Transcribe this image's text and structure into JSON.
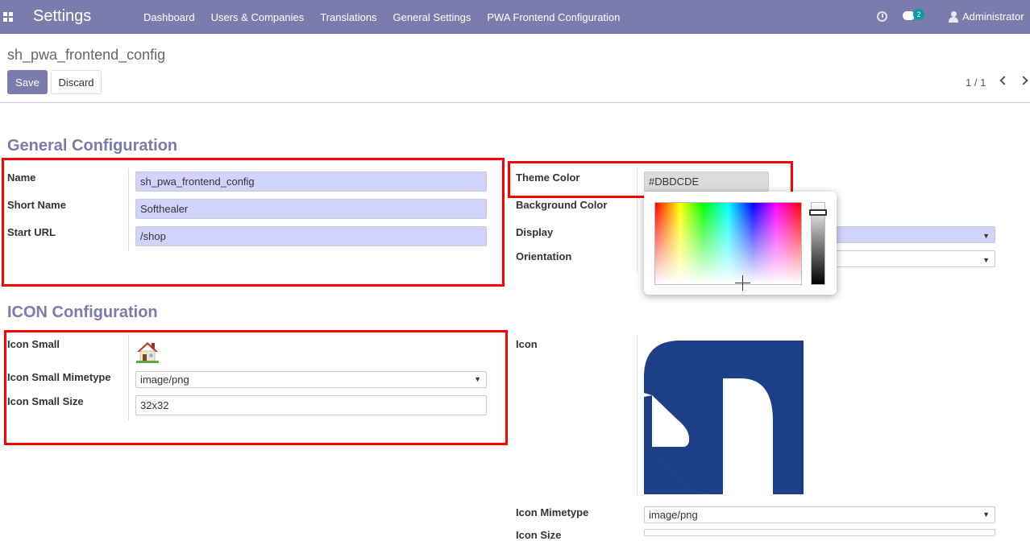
{
  "topbar": {
    "app_title": "Settings",
    "menu": [
      "Dashboard",
      "Users & Companies",
      "Translations",
      "General Settings",
      "PWA Frontend Configuration"
    ],
    "chat_count": "2",
    "user": "Administrator",
    "icons": [
      "apps-icon",
      "clock-icon",
      "chat-icon",
      "user-icon"
    ]
  },
  "control_panel": {
    "breadcrumb": "sh_pwa_frontend_config",
    "save_label": "Save",
    "discard_label": "Discard",
    "pager": "1 / 1"
  },
  "general": {
    "title": "General Configuration",
    "name_label": "Name",
    "name_value": "sh_pwa_frontend_config",
    "short_name_label": "Short Name",
    "short_name_value": "Softhealer",
    "start_url_label": "Start URL",
    "start_url_value": "/shop",
    "theme_color_label": "Theme Color",
    "theme_color_value": "#DBDCDE",
    "background_color_label": "Background Color",
    "display_label": "Display",
    "orientation_label": "Orientation"
  },
  "icon": {
    "title": "ICON Configuration",
    "icon_small_label": "Icon Small",
    "icon_small_mimetype_label": "Icon Small Mimetype",
    "icon_small_mimetype_value": "image/png",
    "icon_small_size_label": "Icon Small Size",
    "icon_small_size_value": "32x32",
    "icon_label": "Icon",
    "icon_mimetype_label": "Icon Mimetype",
    "icon_mimetype_value": "image/png",
    "icon_size_label": "Icon Size"
  },
  "colors": {
    "topbar": "#7c7bad",
    "highlight": "#ff0000",
    "required_field": "#d2d2ff",
    "logo_blue": "#1c3f87"
  }
}
